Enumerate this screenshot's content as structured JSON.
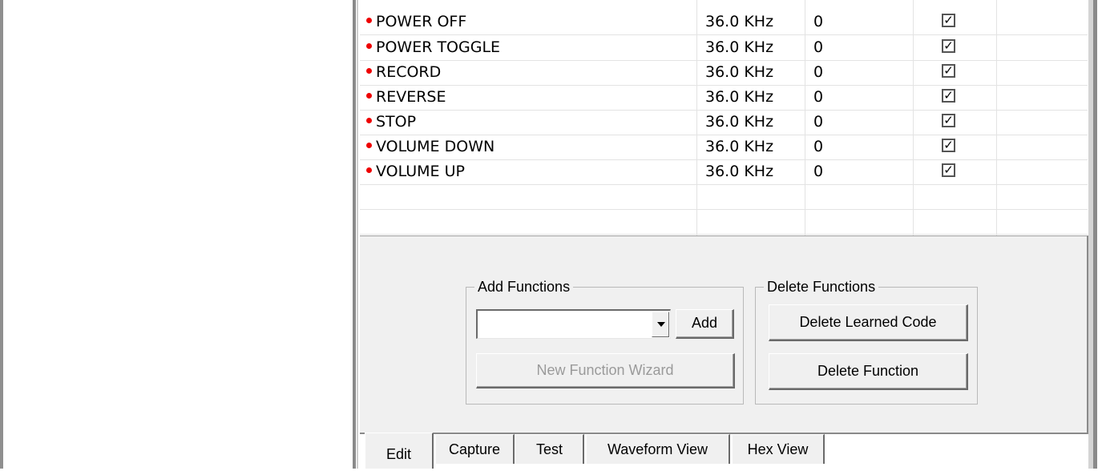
{
  "functions_list": {
    "rows": [
      {
        "name": "POWER OFF",
        "frequency": "36.0 KHz",
        "repeat": "0",
        "checked": true
      },
      {
        "name": "POWER TOGGLE",
        "frequency": "36.0 KHz",
        "repeat": "0",
        "checked": true
      },
      {
        "name": "RECORD",
        "frequency": "36.0 KHz",
        "repeat": "0",
        "checked": true
      },
      {
        "name": "REVERSE",
        "frequency": "36.0 KHz",
        "repeat": "0",
        "checked": true
      },
      {
        "name": "STOP",
        "frequency": "36.0 KHz",
        "repeat": "0",
        "checked": true
      },
      {
        "name": "VOLUME DOWN",
        "frequency": "36.0 KHz",
        "repeat": "0",
        "checked": true
      },
      {
        "name": "VOLUME UP",
        "frequency": "36.0 KHz",
        "repeat": "0",
        "checked": true
      }
    ],
    "check_mark": "✓",
    "dot_color": "#ee0000"
  },
  "add_group": {
    "title": "Add Functions",
    "combo_value": "",
    "add_label": "Add",
    "wizard_label": "New Function Wizard"
  },
  "delete_group": {
    "title": "Delete Functions",
    "delete_learned_label": "Delete Learned Code",
    "delete_function_label": "Delete Function"
  },
  "tabs": [
    {
      "label": "Edit",
      "active": true
    },
    {
      "label": "Capture",
      "active": false
    },
    {
      "label": "Test",
      "active": false
    },
    {
      "label": "Waveform View",
      "active": false
    },
    {
      "label": "Hex View",
      "active": false
    }
  ]
}
